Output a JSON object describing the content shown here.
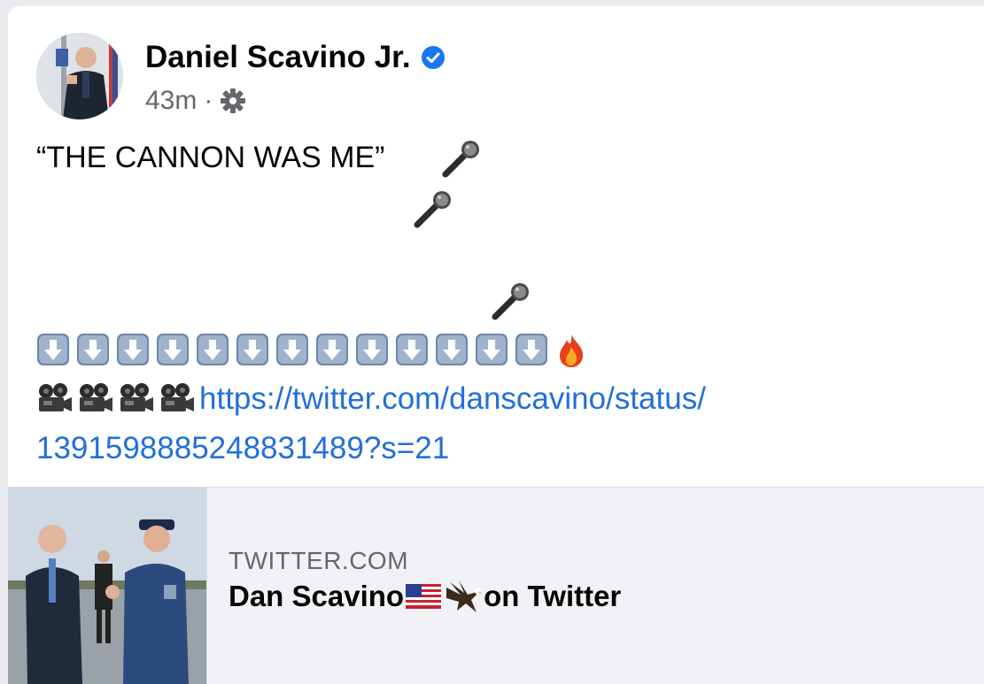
{
  "post": {
    "author": "Daniel Scavino Jr.",
    "time": "43m",
    "separator": "·",
    "text_line1": "“THE CANNON WAS ME”",
    "link_line1": "https://twitter.com/danscavino/status/",
    "link_line2": "1391598885248831489?s=21",
    "icons": {
      "verified": "verified-badge-icon",
      "privacy": "gear-icon",
      "microphone": "microphone-emoji",
      "down_arrow": "down-arrow-key-emoji",
      "fire": "fire-emoji",
      "camera": "movie-camera-emoji"
    },
    "down_arrow_count": 13,
    "camera_count": 4
  },
  "link_preview": {
    "domain": "TWITTER.COM",
    "title_prefix": "Dan Scavino",
    "title_suffix": " on Twitter",
    "title_icons": [
      "us-flag-emoji",
      "eagle-emoji"
    ]
  },
  "colors": {
    "link": "#216fdb",
    "verified": "#1877f2",
    "secondary_text": "#65676b",
    "preview_bg": "#f0f2f5"
  }
}
